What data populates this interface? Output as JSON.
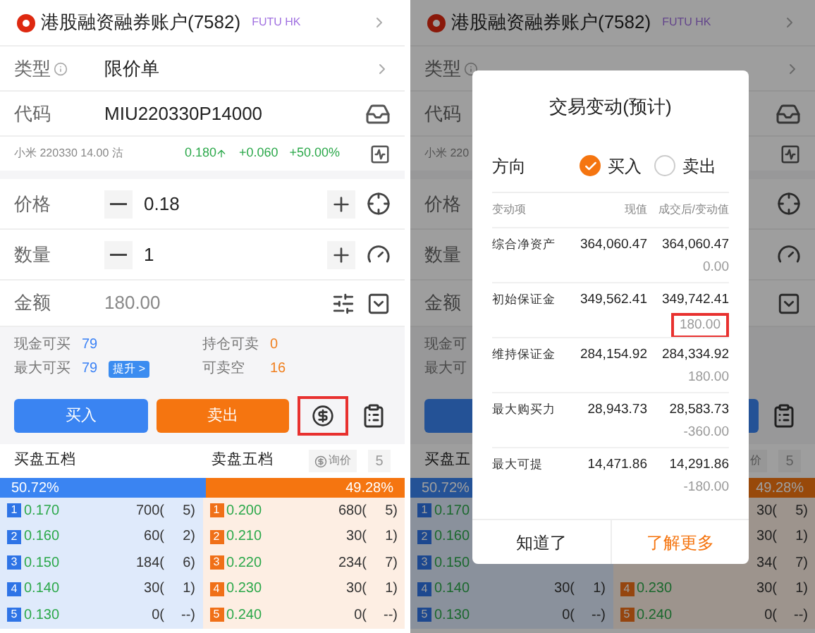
{
  "left": {
    "account": {
      "name": "港股融资融券账户(7582)",
      "broker": "FUTU HK"
    },
    "order_type": {
      "label": "类型",
      "value": "限价单"
    },
    "code": {
      "label": "代码",
      "value": "MIU220330P14000"
    },
    "quote": {
      "name": "小米 220330 14.00 沽",
      "price": "0.180",
      "change": "+0.060",
      "change_pct": "+50.00%"
    },
    "price": {
      "label": "价格",
      "value": "0.18"
    },
    "quantity": {
      "label": "数量",
      "value": "1"
    },
    "amount": {
      "label": "金额",
      "value": "180.00"
    },
    "info": [
      {
        "label": "现金可买",
        "value": "79",
        "kind": "buy"
      },
      {
        "label": "持仓可卖",
        "value": "0",
        "kind": "sell"
      },
      {
        "label": "最大可买",
        "value": "79",
        "kind": "buy",
        "badge": "提升 >"
      },
      {
        "label": "可卖空",
        "value": "16",
        "kind": "sell"
      }
    ],
    "buttons": [
      {
        "kind": "buy",
        "label": "买入"
      },
      {
        "kind": "sell",
        "label": "卖出"
      },
      {
        "kind": "fee",
        "highlighted": true
      },
      {
        "kind": "orders"
      }
    ],
    "order_book": {
      "bid_title": "买盘五档",
      "ask_title": "卖盘五档",
      "quote_button": "询价",
      "quote_icon": true,
      "depth_button": "5",
      "bid_share": "50.72%",
      "ask_share": "49.28%",
      "level": 0.5072,
      "bids": [
        {
          "rank": "1",
          "price": "0.170",
          "volume": "700(",
          "orders": "5)"
        },
        {
          "rank": "2",
          "price": "0.160",
          "volume": "60(",
          "orders": "2)"
        },
        {
          "rank": "3",
          "price": "0.150",
          "volume": "184(",
          "orders": "6)"
        },
        {
          "rank": "4",
          "price": "0.140",
          "volume": "30(",
          "orders": "1)"
        },
        {
          "rank": "5",
          "price": "0.130",
          "volume": "0(",
          "orders": "--)"
        }
      ],
      "asks": [
        {
          "rank": "1",
          "price": "0.200",
          "volume": "680(",
          "orders": "5)"
        },
        {
          "rank": "2",
          "price": "0.210",
          "volume": "30(",
          "orders": "1)"
        },
        {
          "rank": "3",
          "price": "0.220",
          "volume": "234(",
          "orders": "7)"
        },
        {
          "rank": "4",
          "price": "0.230",
          "volume": "30(",
          "orders": "1)"
        },
        {
          "rank": "5",
          "price": "0.240",
          "volume": "0(",
          "orders": "--)"
        }
      ]
    }
  },
  "right": {
    "account": {
      "name": "港股融资融券账户(7582)",
      "broker": "FUTU HK"
    },
    "order_type": {
      "label": "类型"
    },
    "code": {
      "label": "代码"
    },
    "quote": {
      "name": "小米 220"
    },
    "price": {
      "label": "价格"
    },
    "quantity": {
      "label": "数量"
    },
    "amount": {
      "label": "金额"
    },
    "info": [
      {
        "label": "现金可",
        "kind": "buy"
      },
      {
        "label": "最大可",
        "kind": "buy"
      }
    ],
    "buttons": [
      {
        "kind": "buy"
      },
      {
        "kind": "orders"
      }
    ],
    "order_book": {
      "bid_title": "买盘五",
      "quote_button": "价",
      "quote_icon": false,
      "depth_button": "5",
      "bid_share": "50.72%",
      "ask_share": "49.28%",
      "level": 0.5072,
      "bids": [
        {
          "rank": "1",
          "price": "0.170"
        },
        {
          "rank": "2",
          "price": "0.160"
        },
        {
          "rank": "3",
          "price": "0.150"
        },
        {
          "rank": "4",
          "price": "0.140",
          "volume": "30(",
          "orders": "1)"
        },
        {
          "rank": "5",
          "price": "0.130",
          "volume": "0(",
          "orders": "--)"
        }
      ],
      "asks": [
        {
          "volume": "30(",
          "orders": "5)"
        },
        {
          "volume": "30(",
          "orders": "1)"
        },
        {
          "volume": "34(",
          "orders": "7)"
        },
        {
          "rank": "4",
          "price": "0.230",
          "volume": "30(",
          "orders": "1)"
        },
        {
          "rank": "5",
          "price": "0.240",
          "volume": "0(",
          "orders": "--)"
        }
      ]
    }
  },
  "dialog": {
    "title": "交易变动(预计)",
    "direction_label": "方向",
    "options": [
      {
        "label": "买入",
        "selected": true
      },
      {
        "label": "卖出",
        "selected": false
      }
    ],
    "columns": [
      "变动项",
      "现值",
      "成交后/变动值"
    ],
    "rows": [
      {
        "item": "综合净资产",
        "current": "364,060.47",
        "after": "364,060.47",
        "change": "0.00",
        "highlighted": false
      },
      {
        "item": "初始保证金",
        "current": "349,562.41",
        "after": "349,742.41",
        "change": "180.00",
        "highlighted": true
      },
      {
        "item": "维持保证金",
        "current": "284,154.92",
        "after": "284,334.92",
        "change": "180.00",
        "highlighted": false
      },
      {
        "item": "最大购买力",
        "current": "28,943.73",
        "after": "28,583.73",
        "change": "-360.00",
        "highlighted": false
      },
      {
        "item": "最大可提",
        "current": "14,471.86",
        "after": "14,291.86",
        "change": "-180.00",
        "highlighted": false
      }
    ],
    "buttons": [
      {
        "label": "知道了",
        "kind": "plain"
      },
      {
        "label": "了解更多",
        "kind": "accent"
      }
    ]
  }
}
